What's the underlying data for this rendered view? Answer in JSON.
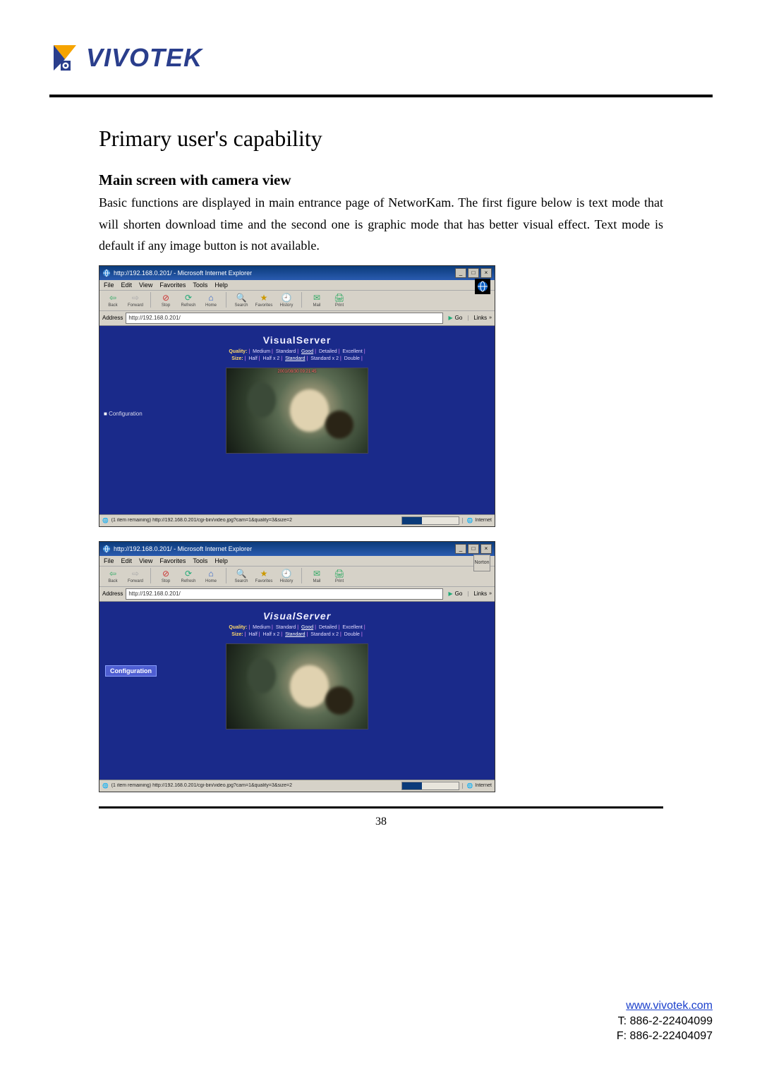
{
  "logo": {
    "text": "VIVOTEK"
  },
  "headings": {
    "h1": "Primary user's capability",
    "h2": "Main screen with camera view"
  },
  "paragraph": "Basic functions are displayed in main entrance page of NetworKam. The first figure below is text mode that will shorten download time and the second one is graphic mode that has better visual effect. Text mode is default if any image button is not available.",
  "browser": {
    "title": "http://192.168.0.201/ - Microsoft Internet Explorer",
    "menus": {
      "file": "File",
      "edit": "Edit",
      "view": "View",
      "favorites": "Favorites",
      "tools": "Tools",
      "help": "Help"
    },
    "toolbar": {
      "back": "Back",
      "forward": "Forward",
      "stop": "Stop",
      "refresh": "Refresh",
      "home": "Home",
      "search": "Search",
      "favorites": "Favorites",
      "history": "History",
      "mail": "Mail",
      "print": "Print"
    },
    "address_label": "Address",
    "address_value": "http://192.168.0.201/",
    "go": "Go",
    "links": "Links",
    "zone": "Internet"
  },
  "visualserver": {
    "title": "VisualServer",
    "quality_label": "Quality:",
    "quality_opts": [
      "Medium",
      "Standard",
      "Good",
      "Detailed",
      "Excellent"
    ],
    "quality_selected": "Good",
    "size_label": "Size:",
    "size_opts": [
      "Half",
      "Half x 2",
      "Standard",
      "Standard x 2",
      "Double"
    ],
    "size_selected": "Standard",
    "config_text": "Configuration",
    "video_overlay": "2001/08/30 09:21:45"
  },
  "status": {
    "text_mode": "(1 item remaining) http://192.168.0.201/cgi-bin/video.jpg?cam=1&quality=3&size=2",
    "graphic_mode": "(1 item remaining) http://192.168.0.201/cgi-bin/video.jpg?cam=1&quality=3&size=2",
    "progress_pct": 35
  },
  "page_number": "38",
  "footer": {
    "url_text": "www.vivotek.com",
    "tel": "T: 886-2-22404099",
    "fax": "F: 886-2-22404097"
  }
}
